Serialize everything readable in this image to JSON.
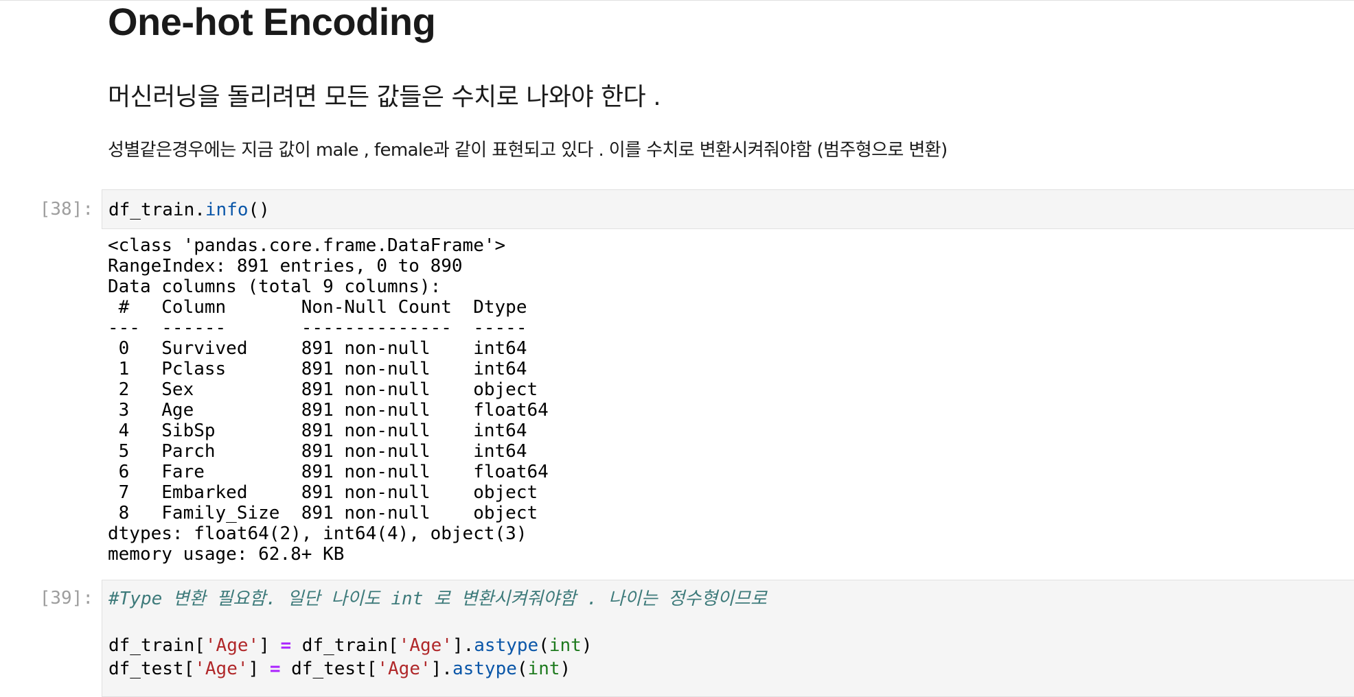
{
  "markdown": {
    "heading1": "One-hot Encoding",
    "heading2": "머신러닝을 돌리려면 모든 값들은 수치로 나와야 한다 .",
    "paragraph": "성별같은경우에는 지금 값이 male , female과 같이 표현되고 있다 . 이를 수치로 변환시켜줘야함 (범주형으로 변환)"
  },
  "cell38": {
    "prompt": "[38]:",
    "code": {
      "obj": "df_train.",
      "method": "info",
      "parens": "()"
    },
    "output_lines": [
      "<class 'pandas.core.frame.DataFrame'>",
      "RangeIndex: 891 entries, 0 to 890",
      "Data columns (total 9 columns):",
      " #   Column       Non-Null Count  Dtype  ",
      "---  ------       --------------  -----  ",
      " 0   Survived     891 non-null    int64  ",
      " 1   Pclass       891 non-null    int64  ",
      " 2   Sex          891 non-null    object ",
      " 3   Age          891 non-null    float64",
      " 4   SibSp        891 non-null    int64  ",
      " 5   Parch        891 non-null    int64  ",
      " 6   Fare         891 non-null    float64",
      " 7   Embarked     891 non-null    object ",
      " 8   Family_Size  891 non-null    object ",
      "dtypes: float64(2), int64(4), object(3)",
      "memory usage: 62.8+ KB"
    ]
  },
  "cell39": {
    "prompt": "[39]:",
    "comment": "#Type 변환 필요함. 일단 나이도 int 로 변환시켜줘야함 . 나이는 정수형이므로",
    "line1": {
      "var": "df_train[",
      "key": "'Age'",
      "close": "] ",
      "eq": "=",
      "rhs_var": " df_train[",
      "rhs_key": "'Age'",
      "rhs_close": "].",
      "method": "astype",
      "open": "(",
      "arg": "int",
      "end": ")"
    },
    "line2": {
      "var": "df_test[",
      "key": "'Age'",
      "close": "] ",
      "eq": "=",
      "rhs_var": " df_test[",
      "rhs_key": "'Age'",
      "rhs_close": "].",
      "method": "astype",
      "open": "(",
      "arg": "int",
      "end": ")"
    }
  },
  "colors": {
    "cell_bg": "#f5f5f5",
    "cell_border": "#e0e0e0",
    "prompt": "#9e9e9e",
    "string": "#b0282a",
    "method": "#0a56a8",
    "builtin": "#1e7a1e",
    "operator": "#aa22ff",
    "comment": "#3d7a7a"
  }
}
